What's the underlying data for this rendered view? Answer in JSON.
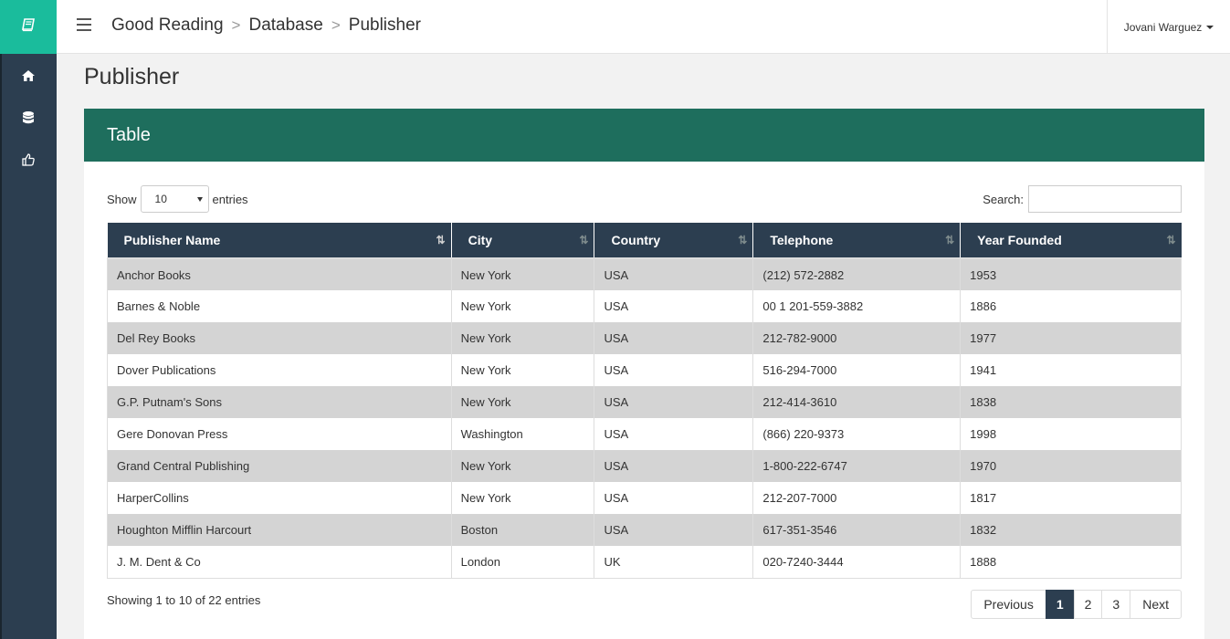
{
  "app": {
    "brand_icon": "book-icon",
    "accent": "#1abc9c",
    "header_color": "#1e6e5d",
    "dark": "#2c3e50"
  },
  "sidebar": {
    "items": [
      {
        "icon": "home-icon"
      },
      {
        "icon": "database-icon"
      },
      {
        "icon": "thumbs-up-icon"
      }
    ]
  },
  "header": {
    "breadcrumb": [
      "Good Reading",
      "Database",
      "Publisher"
    ],
    "user": "Jovani Warguez"
  },
  "page": {
    "title": "Publisher"
  },
  "panel": {
    "title": "Table",
    "show_label": "Show",
    "entries_label": "entries",
    "page_length": "10",
    "search_label": "Search:",
    "search_value": "",
    "columns": [
      "Publisher Name",
      "City",
      "Country",
      "Telephone",
      "Year Founded"
    ],
    "rows": [
      [
        "Anchor Books",
        "New York",
        "USA",
        "(212) 572-2882",
        "1953"
      ],
      [
        "Barnes & Noble",
        "New York",
        "USA",
        "00 1 201-559-3882",
        "1886"
      ],
      [
        "Del Rey Books",
        "New York",
        "USA",
        "212-782-9000",
        "1977"
      ],
      [
        "Dover Publications",
        "New York",
        "USA",
        "516-294-7000",
        "1941"
      ],
      [
        "G.P. Putnam's Sons",
        "New York",
        "USA",
        "212-414-3610",
        "1838"
      ],
      [
        "Gere Donovan Press",
        "Washington",
        "USA",
        "(866) 220-9373",
        "1998"
      ],
      [
        "Grand Central Publishing",
        "New York",
        "USA",
        "1-800-222-6747",
        "1970"
      ],
      [
        "HarperCollins",
        "New York",
        "USA",
        "212-207-7000",
        "1817"
      ],
      [
        "Houghton Mifflin Harcourt",
        "Boston",
        "USA",
        "617-351-3546",
        "1832"
      ],
      [
        "J. M. Dent & Co",
        "London",
        "UK",
        "020-7240-3444",
        "1888"
      ]
    ],
    "info": "Showing 1 to 10 of 22 entries",
    "pagination": {
      "previous": "Previous",
      "pages": [
        "1",
        "2",
        "3"
      ],
      "current": "1",
      "next": "Next"
    }
  }
}
